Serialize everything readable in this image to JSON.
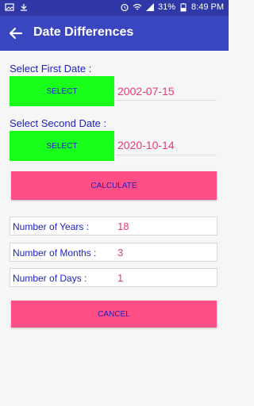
{
  "status_bar": {
    "battery": "31%",
    "time": "8:49 PM"
  },
  "app_bar": {
    "title": "Date Differences"
  },
  "first_date": {
    "label": "Select First Date :",
    "button_label": "SELECT",
    "value": "2002-07-15"
  },
  "second_date": {
    "label": "Select Second Date :",
    "button_label": "SELECT",
    "value": "2020-10-14"
  },
  "calculate_label": "CALCULATE",
  "results": {
    "years": {
      "label": "Number of Years :",
      "value": "18"
    },
    "months": {
      "label": "Number of Months :",
      "value": "3"
    },
    "days": {
      "label": "Number of Days :",
      "value": "1"
    }
  },
  "cancel_label": "CANCEL"
}
